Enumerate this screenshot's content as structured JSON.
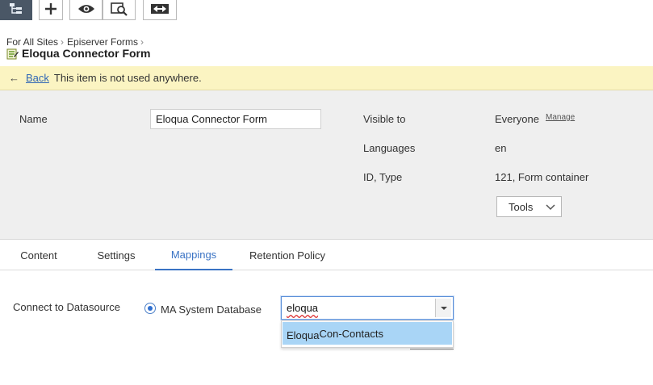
{
  "toolbar": {
    "buttons": [
      {
        "name": "tree-view",
        "icon": "tree-structure-icon",
        "active": true
      },
      {
        "name": "add",
        "icon": "plus-icon"
      },
      {
        "name": "view",
        "icon": "eye-icon"
      },
      {
        "name": "preview",
        "icon": "preview-magnifier-icon"
      },
      {
        "name": "compare",
        "icon": "compare-arrows-icon"
      }
    ]
  },
  "breadcrumb": {
    "items": [
      "For All Sites",
      "Episerver Forms"
    ]
  },
  "title": {
    "icon": "form-icon",
    "text": "Eloqua Connector Form"
  },
  "notice": {
    "back_label": "Back",
    "message": "This item is not used anywhere."
  },
  "properties": {
    "name_label": "Name",
    "name_value": "Eloqua Connector Form",
    "visible_to_label": "Visible to",
    "visible_to_value": "Everyone",
    "manage_label": "Manage",
    "languages_label": "Languages",
    "languages_value": "en",
    "id_type_label": "ID, Type",
    "id_type_value": "121, Form container",
    "tools_label": "Tools"
  },
  "tabs": [
    {
      "label": "Content",
      "active": false
    },
    {
      "label": "Settings",
      "active": false
    },
    {
      "label": "Mappings",
      "active": true
    },
    {
      "label": "Retention Policy",
      "active": false
    }
  ],
  "mappings": {
    "connect_label": "Connect to Datasource",
    "radio_label": "MA System Database",
    "radio_selected": true,
    "combo_value": "eloqua",
    "suggestion_match": "Eloqua",
    "suggestion_rest": "Con-Contacts"
  },
  "colors": {
    "accent": "#3a73c4",
    "notice_bg": "#fbf4c2",
    "highlight": "#a9d5f6",
    "panel_bg": "#efefef"
  }
}
